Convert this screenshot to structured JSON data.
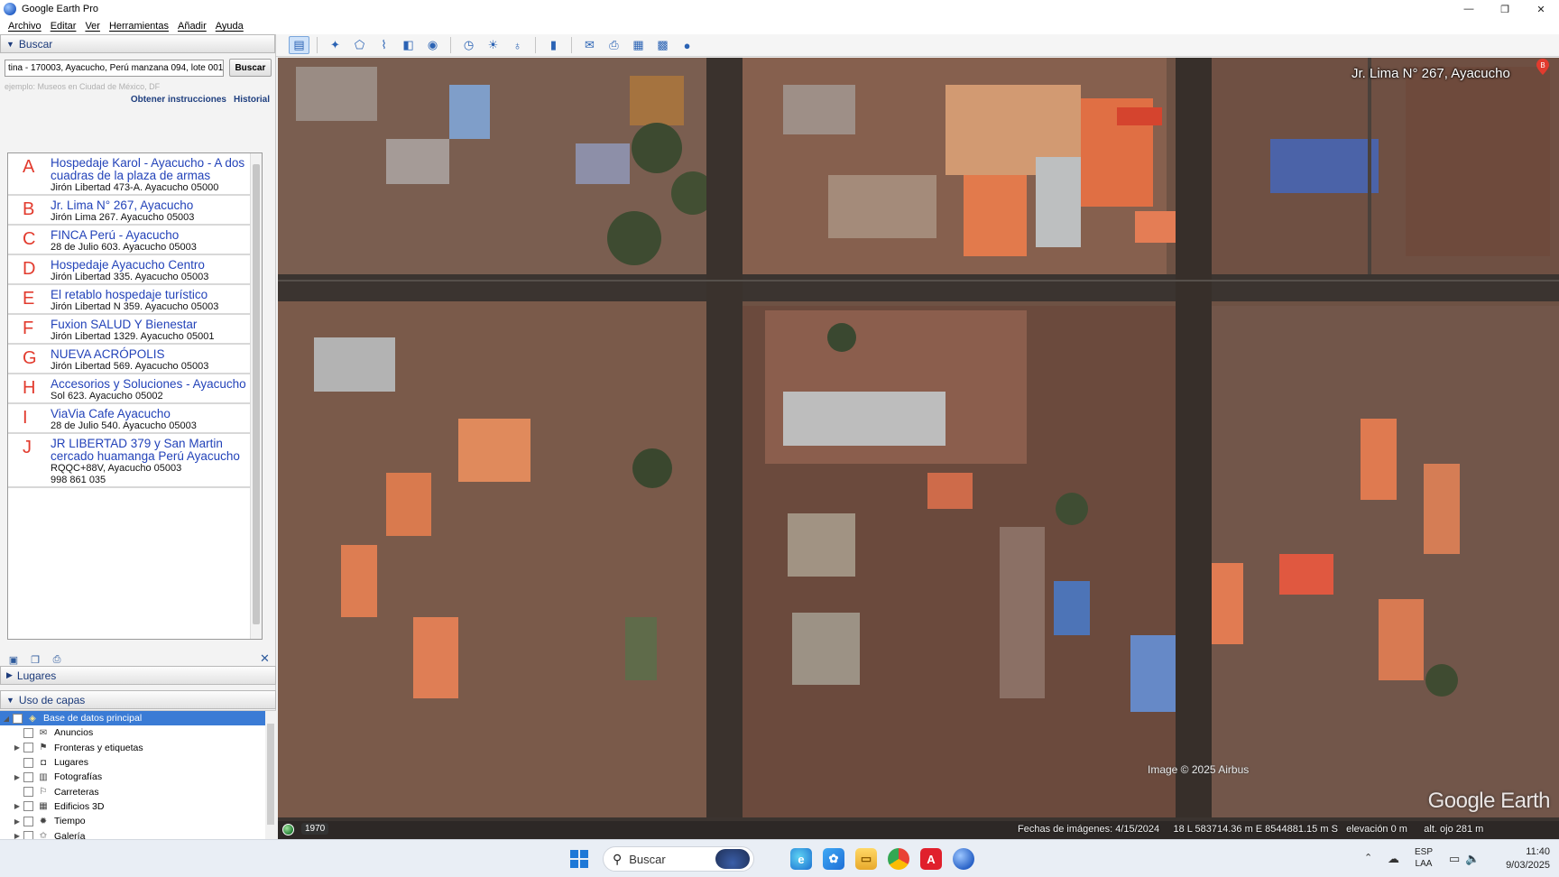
{
  "window": {
    "title": "Google Earth Pro",
    "controls": [
      "—",
      "❐",
      "✕"
    ]
  },
  "menubar": [
    "Archivo",
    "Editar",
    "Ver",
    "Herramientas",
    "Añadir",
    "Ayuda"
  ],
  "search_panel": {
    "header": "Buscar",
    "input_value": "tina - 170003, Ayacucho, Perú  manzana 094, lote 001",
    "search_button": "Buscar",
    "example_hint": "ejemplo: Museos en Ciudad de México, DF",
    "directions_link": "Obtener instrucciones",
    "history_link": "Historial",
    "results": [
      {
        "letter": "A",
        "name": "Hospedaje Karol - Ayacucho - A dos cuadras de la plaza de armas",
        "address": "Jirón Libertad 473-A. Ayacucho 05000"
      },
      {
        "letter": "B",
        "name": "Jr. Lima N° 267, Ayacucho",
        "address": "Jirón Lima 267. Ayacucho 05003"
      },
      {
        "letter": "C",
        "name": "FINCA Perú - Ayacucho",
        "address": "28 de Julio 603. Ayacucho 05003"
      },
      {
        "letter": "D",
        "name": "Hospedaje Ayacucho Centro",
        "address": "Jirón Libertad 335. Ayacucho 05003"
      },
      {
        "letter": "E",
        "name": "El retablo hospedaje turístico",
        "address": "Jirón Libertad N 359. Ayacucho 05003"
      },
      {
        "letter": "F",
        "name": "Fuxion SALUD Y Bienestar",
        "address": "Jirón Libertad 1329. Ayacucho 05001"
      },
      {
        "letter": "G",
        "name": "NUEVA ACRÓPOLIS",
        "address": "Jirón Libertad 569. Ayacucho 05003"
      },
      {
        "letter": "H",
        "name": "Accesorios y Soluciones - Ayacucho",
        "address": "Sol 623. Ayacucho 05002"
      },
      {
        "letter": "I",
        "name": "ViaVia Cafe Ayacucho",
        "address": "28 de Julio 540. Ayacucho 05003"
      },
      {
        "letter": "J",
        "name": "JR LIBERTAD 379 y San Martin cercado huamanga Perú Ayacucho",
        "address": "RQQC+88V, Ayacucho 05003",
        "phone": "998 861 035"
      }
    ],
    "tools": [
      "add-folder-icon",
      "copy-icon",
      "print-icon"
    ],
    "close": "✕"
  },
  "places_panel": {
    "header": "Lugares"
  },
  "layers_panel": {
    "header": "Uso de capas",
    "items": [
      {
        "label": "Base de datos principal",
        "icon": "globe-db",
        "selected": true,
        "expandable": true
      },
      {
        "label": "Anuncios",
        "icon": "envelope",
        "expandable": false
      },
      {
        "label": "Fronteras y etiquetas",
        "icon": "flag",
        "expandable": true
      },
      {
        "label": "Lugares",
        "icon": "square-pin",
        "expandable": false
      },
      {
        "label": "Fotografías",
        "icon": "photo",
        "expandable": true
      },
      {
        "label": "Carreteras",
        "icon": "signpost",
        "expandable": false
      },
      {
        "label": "Edificios 3D",
        "icon": "building",
        "expandable": true
      },
      {
        "label": "Tiempo",
        "icon": "sun",
        "expandable": true
      },
      {
        "label": "Galería",
        "icon": "star",
        "expandable": true
      }
    ]
  },
  "toolbar": {
    "buttons": [
      "sidebar-toggle-icon",
      "placemark-icon",
      "polygon-icon",
      "path-icon",
      "overlay-icon",
      "tour-icon",
      "historical-imagery-icon",
      "sunlight-icon",
      "planets-icon",
      "ruler-icon",
      "email-icon",
      "print-icon",
      "save-image-icon",
      "view-in-maps-icon",
      "earth-gallery-icon"
    ]
  },
  "map": {
    "place_label": "Jr. Lima N° 267, Ayacucho",
    "pin_letter": "B",
    "credit": "Image © 2025 Airbus",
    "logo": "Google Earth",
    "status": {
      "imagery_year": "1970",
      "imagery_date": "Fechas de imágenes: 4/15/2024",
      "coordinates": "18 L 583714.36 m E 8544881.15 m S",
      "elevation": "elevación    0 m",
      "eye_altitude": "alt. ojo    281 m"
    }
  },
  "taskbar": {
    "search_label": "Buscar",
    "apps": [
      "edge",
      "photos",
      "file-explorer",
      "chrome",
      "acrobat",
      "google-earth"
    ],
    "language": [
      "ESP",
      "LAA"
    ],
    "time": "11:40",
    "date": "9/03/2025"
  },
  "colors": {
    "accent": "#3a7bd5",
    "result_link": "#2343b9",
    "result_letter": "#e23b2e",
    "roof_terracotta": "#c8603e",
    "roof_dark": "#6d5143"
  }
}
